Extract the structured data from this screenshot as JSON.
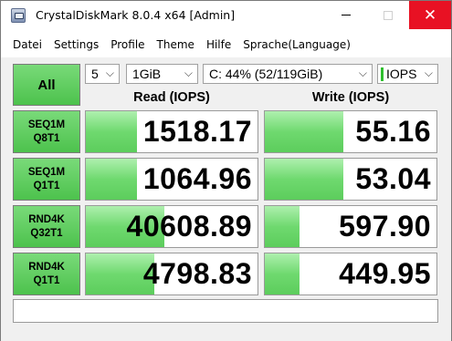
{
  "window": {
    "title": "CrystalDiskMark 8.0.4 x64 [Admin]",
    "close_glyph": "✕"
  },
  "menu": [
    "Datei",
    "Settings",
    "Profile",
    "Theme",
    "Hilfe",
    "Sprache(Language)"
  ],
  "controls": {
    "all_label": "All",
    "count": "5",
    "size": "1GiB",
    "drive": "C: 44% (52/119GiB)",
    "unit": "IOPS",
    "chevron": "⌵"
  },
  "columns": {
    "read": "Read (IOPS)",
    "write": "Write (IOPS)"
  },
  "tests": [
    {
      "line1": "SEQ1M",
      "line2": "Q8T1",
      "read": "1518.17",
      "write": "55.16",
      "read_level": 0.3,
      "write_level": 0.46
    },
    {
      "line1": "SEQ1M",
      "line2": "Q1T1",
      "read": "1064.96",
      "write": "53.04",
      "read_level": 0.3,
      "write_level": 0.46
    },
    {
      "line1": "RND4K",
      "line2": "Q32T1",
      "read": "40608.89",
      "write": "597.90",
      "read_level": 0.46,
      "write_level": 0.2
    },
    {
      "line1": "RND4K",
      "line2": "Q1T1",
      "read": "4798.83",
      "write": "449.95",
      "read_level": 0.4,
      "write_level": 0.2
    }
  ],
  "colors": {
    "accent_green": "#4dc24d",
    "bar_green": "#6fd96f",
    "close_red": "#e81123"
  },
  "comment": ""
}
